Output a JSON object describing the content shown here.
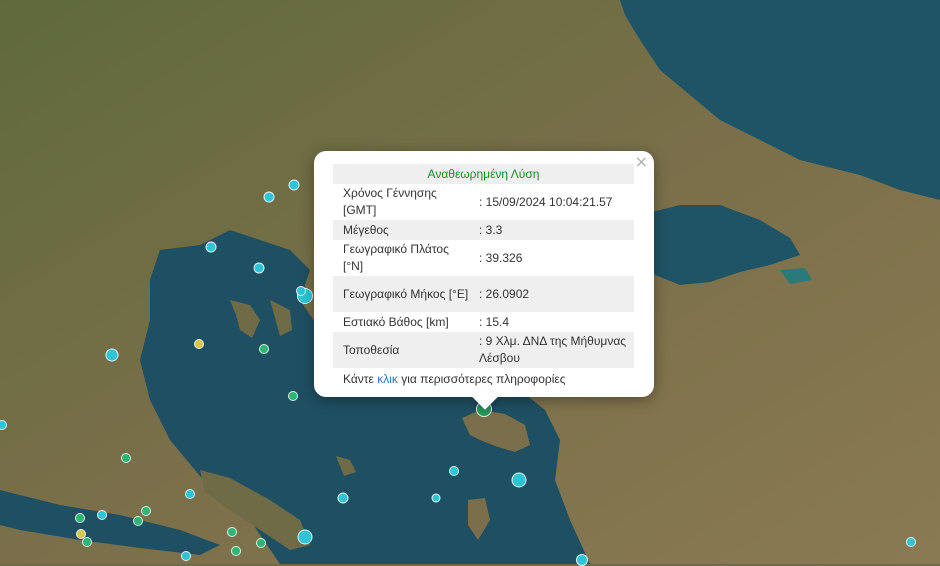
{
  "popup": {
    "title": "Αναθεωρημένη Λύση",
    "close_label": "×",
    "rows": [
      {
        "label": "Χρόνος Γέννησης [GMT]",
        "value": ": 15/09/2024 10:04:21.57"
      },
      {
        "label": "Μέγεθος",
        "value": ": 3.3"
      },
      {
        "label": "Γεωγραφικό Πλάτος [°N]",
        "value": ": 39.326"
      },
      {
        "label": "Γεωγραφικό Μήκος [°E]",
        "value": ": 26.0902"
      },
      {
        "label": "Εστιακό Βάθος [km]",
        "value": ": 15.4"
      },
      {
        "label": "Τοποθεσία",
        "value": ": 9 Χλμ. ΔΝΔ της Μήθυμνας Λέσβου"
      }
    ],
    "more_prefix": "Κάντε ",
    "more_link": "κλικ",
    "more_suffix": " για περισσότερες πληροφορίες"
  },
  "colors": {
    "marker_cyan": "#2ec4d6",
    "marker_green": "#2bb673",
    "marker_yellow": "#d6c84a",
    "selected_marker": "#2a9d5c",
    "sea": "#1f4f62",
    "land": "#6e6b46",
    "title_green": "#1a8a2a",
    "link_blue": "#2a7ab8"
  }
}
